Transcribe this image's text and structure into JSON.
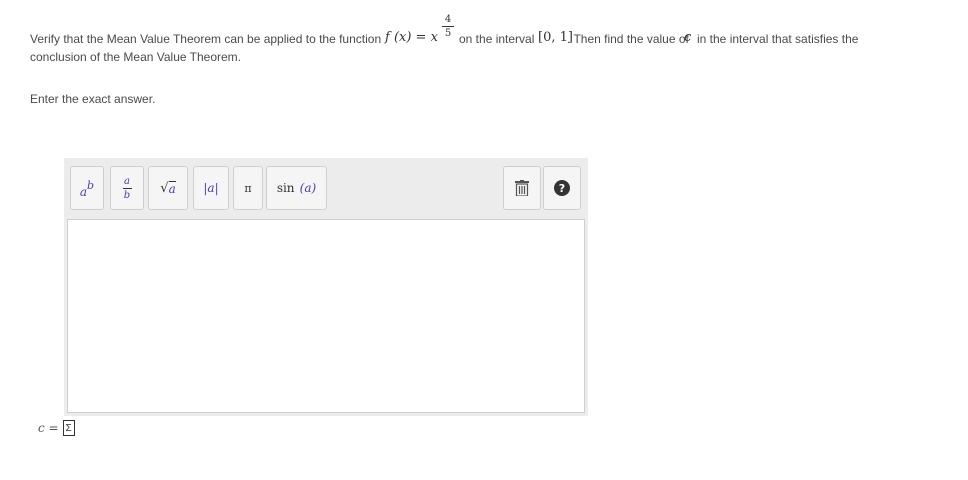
{
  "question": {
    "text_before_function": "Verify that the Mean Value Theorem can be applied to the function",
    "function_lhs": "f (x) = x",
    "exponent_numerator": "4",
    "exponent_denominator": "5",
    "text_on_interval": "on the interval",
    "interval": "[0, 1]",
    "text_find": ". Then find the value of",
    "variable": "c",
    "text_after_variable": "in the interval that satisfies the",
    "line2": "conclusion of the Mean Value Theorem."
  },
  "prompt": "Enter the exact answer.",
  "toolbar": {
    "exponent": {
      "base": "a",
      "exp": "b"
    },
    "fraction": {
      "num": "a",
      "den": "b"
    },
    "sqrt": {
      "symbol": "√",
      "arg": "a"
    },
    "abs": {
      "content": "|a|"
    },
    "pi": {
      "symbol": "π"
    },
    "sin": {
      "func": "sin",
      "arg": "(a)"
    },
    "trash_icon": "trash-icon",
    "help_icon": "help-icon",
    "help_symbol": "?"
  },
  "answer": {
    "variable": "c",
    "equals": "=",
    "sigma_icon": "sigma-icon",
    "sigma_symbol": "Σ"
  }
}
